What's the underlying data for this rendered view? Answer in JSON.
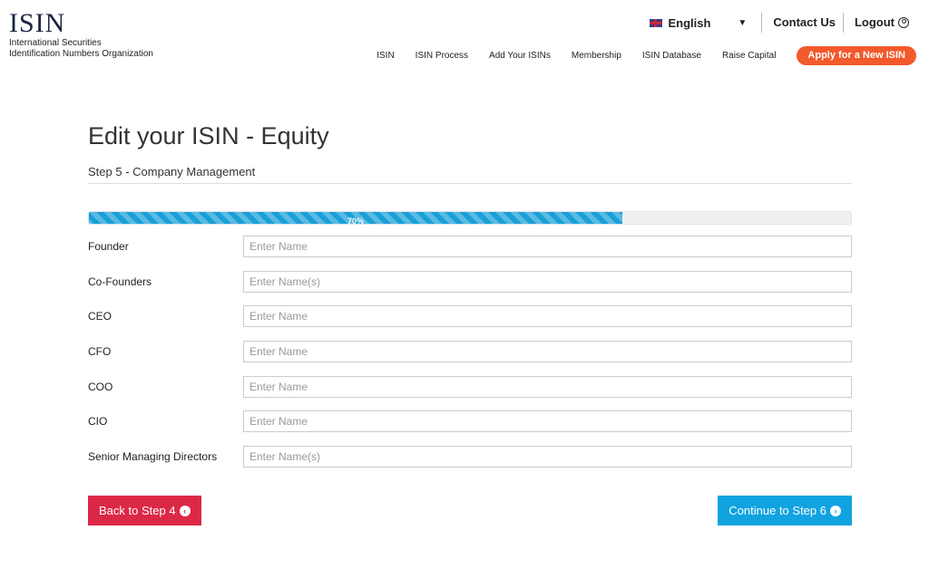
{
  "logo": {
    "title": "ISIN",
    "sub_line1": "International Securities",
    "sub_line2": "Identification Numbers Organization"
  },
  "topbar": {
    "language": "English",
    "contact": "Contact Us",
    "logout": "Logout"
  },
  "nav": {
    "items": [
      "ISIN",
      "ISIN Process",
      "Add Your ISINs",
      "Membership",
      "ISIN Database",
      "Raise Capital"
    ],
    "apply": "Apply for a New ISIN"
  },
  "page": {
    "title": "Edit your ISIN - Equity",
    "step": "Step 5 - Company Management"
  },
  "progress": {
    "value": 70,
    "label": "70%"
  },
  "form": {
    "fields": [
      {
        "label": "Founder",
        "placeholder": "Enter Name"
      },
      {
        "label": "Co-Founders",
        "placeholder": "Enter Name(s)"
      },
      {
        "label": "CEO",
        "placeholder": "Enter Name"
      },
      {
        "label": "CFO",
        "placeholder": "Enter Name"
      },
      {
        "label": "COO",
        "placeholder": "Enter Name"
      },
      {
        "label": "CIO",
        "placeholder": "Enter Name"
      },
      {
        "label": "Senior Managing Directors",
        "placeholder": "Enter Name(s)"
      }
    ]
  },
  "actions": {
    "back": "Back to Step 4",
    "next": "Continue to Step 6"
  },
  "colors": {
    "accent": "#f2592b",
    "progress": "#1a9fd8",
    "back": "#dc2847",
    "next": "#10a3e0"
  },
  "icons": {
    "flag": "uk-flag-icon",
    "caret": "chevron-down-icon",
    "user": "user-circle-icon",
    "back": "arrow-left-circle-icon",
    "next": "arrow-right-circle-icon"
  }
}
